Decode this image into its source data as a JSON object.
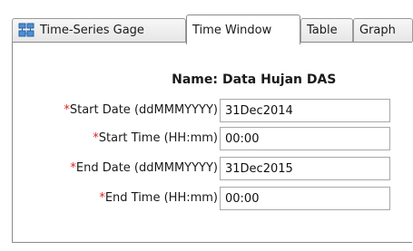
{
  "tabs": [
    {
      "label": "Time-Series Gage",
      "icon": "gage-icon",
      "active": false
    },
    {
      "label": "Time Window",
      "active": true
    },
    {
      "label": "Table",
      "active": false
    },
    {
      "label": "Graph",
      "active": false
    }
  ],
  "form": {
    "name_label": "Name:",
    "name_value": "Data Hujan DAS",
    "required_mark": "*",
    "fields": [
      {
        "label": "Start Date (ddMMMYYYY)",
        "value": "31Dec2014"
      },
      {
        "label": "Start Time (HH:mm)",
        "value": "00:00"
      },
      {
        "label": "End Date (ddMMMYYYY)",
        "value": "31Dec2015"
      },
      {
        "label": "End Time (HH:mm)",
        "value": "00:00"
      }
    ]
  },
  "colors": {
    "required": "#e02020",
    "border": "#8a8a8a"
  }
}
